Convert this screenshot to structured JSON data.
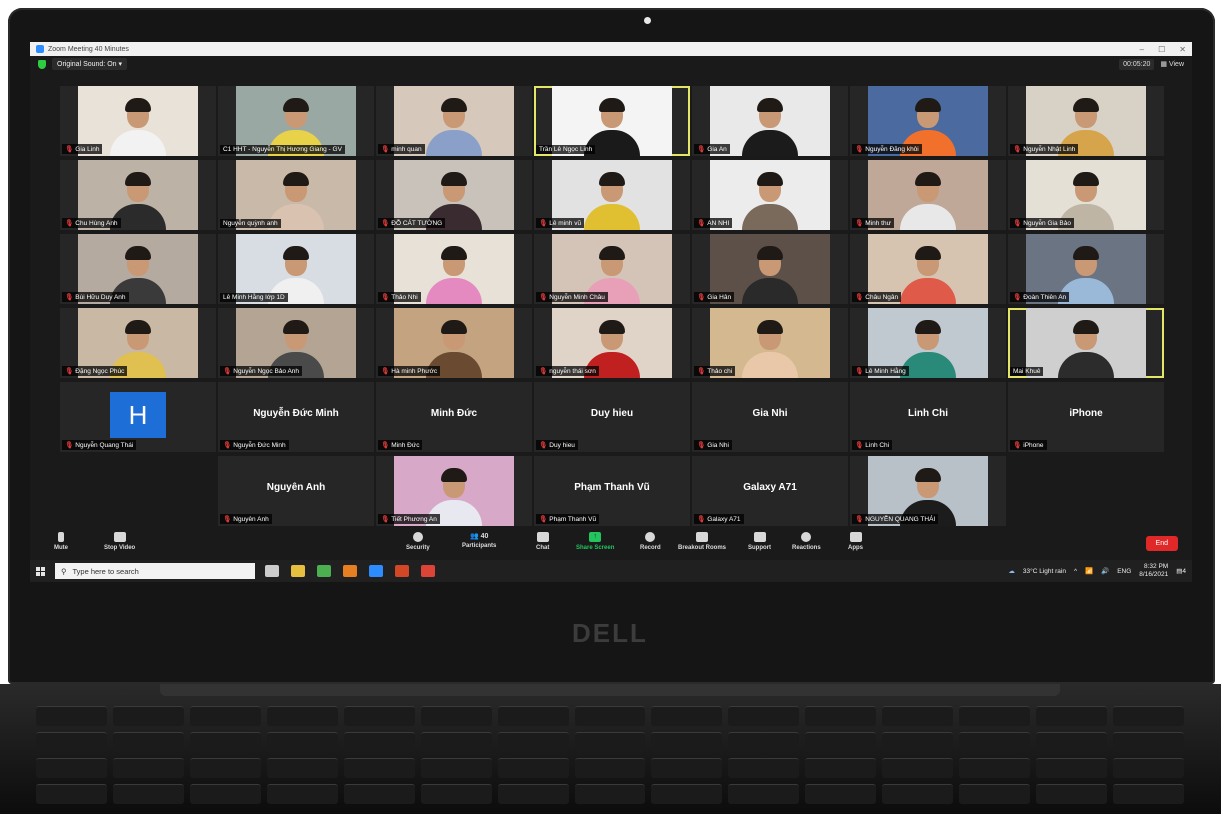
{
  "window": {
    "title": "Zoom Meeting 40 Minutes"
  },
  "topbar": {
    "sound_label": "Original Sound: On",
    "timer": "00:05:20",
    "view_label": "View"
  },
  "brand": "DELL",
  "tiles": [
    {
      "name": "Gia Linh",
      "muted": true,
      "video": true,
      "bg": "#e9e2d8",
      "shirt": "#f2f2f2"
    },
    {
      "name": "C1 HHT - Nguyễn Thị Hương Giang - GV",
      "muted": false,
      "video": true,
      "bg": "#9aa8a4",
      "shirt": "#e8d24a"
    },
    {
      "name": "minh quan",
      "muted": true,
      "video": true,
      "bg": "#d7c8bc",
      "shirt": "#8aa0c8"
    },
    {
      "name": "Trần Lê Ngọc Linh",
      "muted": false,
      "video": true,
      "bg": "#f4f4f4",
      "shirt": "#1a1a1a",
      "active": true
    },
    {
      "name": "Gia An",
      "muted": true,
      "video": true,
      "bg": "#e9e9e9",
      "shirt": "#1b1b1b"
    },
    {
      "name": "Nguyễn Đăng khôi",
      "muted": true,
      "video": true,
      "bg": "#4a6aa0",
      "shirt": "#f0702c"
    },
    {
      "name": "Nguyễn Nhật Linh",
      "muted": true,
      "video": true,
      "bg": "#d8d2c6",
      "shirt": "#d6a44a"
    },
    {
      "name": "Chu Hùng Anh",
      "muted": true,
      "video": true,
      "bg": "#bcb3a6",
      "shirt": "#2b2b2b"
    },
    {
      "name": "Nguyễn quỳnh anh",
      "muted": false,
      "video": true,
      "bg": "#c9b9a8",
      "shirt": "#d9c2b0"
    },
    {
      "name": "ĐỖ CÁT TƯỜNG",
      "muted": true,
      "video": true,
      "bg": "#c8c2ba",
      "shirt": "#3a2b30"
    },
    {
      "name": "Lê minh vũ",
      "muted": true,
      "video": true,
      "bg": "#e2e2e2",
      "shirt": "#e0c030"
    },
    {
      "name": "AN NHI",
      "muted": true,
      "video": true,
      "bg": "#ececec",
      "shirt": "#7a6a5c"
    },
    {
      "name": "Minh thư",
      "muted": true,
      "video": true,
      "bg": "#c0a898",
      "shirt": "#e8e8e8"
    },
    {
      "name": "Nguyễn Gia Bảo",
      "muted": true,
      "video": true,
      "bg": "#e5e0d6",
      "shirt": "#bfb5a5"
    },
    {
      "name": "Bùi Hữu Duy Anh",
      "muted": true,
      "video": true,
      "bg": "#b5aaa0",
      "shirt": "#3a3a3a"
    },
    {
      "name": "Lê Minh Hằng  lớp 1D",
      "muted": false,
      "video": true,
      "bg": "#d8dde4",
      "shirt": "#f0f0f0"
    },
    {
      "name": "Thảo Nhi",
      "muted": true,
      "video": true,
      "bg": "#e8e1d8",
      "shirt": "#e48ac0"
    },
    {
      "name": "Nguyễn Minh Châu",
      "muted": true,
      "video": true,
      "bg": "#d4c4b8",
      "shirt": "#e8a0b8"
    },
    {
      "name": "Gia Hân",
      "muted": true,
      "video": true,
      "bg": "#5c5048",
      "shirt": "#2a2a2a"
    },
    {
      "name": "Châu Ngân",
      "muted": true,
      "video": true,
      "bg": "#d6c4b0",
      "shirt": "#e05a4a"
    },
    {
      "name": "Đoàn Thiên An",
      "muted": true,
      "video": true,
      "bg": "#6a7482",
      "shirt": "#9ab8d8"
    },
    {
      "name": "Đặng Ngọc Phúc",
      "muted": true,
      "video": true,
      "bg": "#c8b8a4",
      "shirt": "#e0c050"
    },
    {
      "name": "Nguyễn Ngọc Bảo Anh",
      "muted": true,
      "video": true,
      "bg": "#b4a494",
      "shirt": "#4a4a4a"
    },
    {
      "name": "Hà minh Phước",
      "muted": true,
      "video": true,
      "bg": "#c4a480",
      "shirt": "#6a4a30"
    },
    {
      "name": "nguyễn thái sơn",
      "muted": true,
      "video": true,
      "bg": "#e0d4c8",
      "shirt": "#c02020"
    },
    {
      "name": "Thảo chi",
      "muted": true,
      "video": true,
      "bg": "#d4b890",
      "shirt": "#e8c8a8"
    },
    {
      "name": "Lê Minh Hằng",
      "muted": true,
      "video": true,
      "bg": "#c0c8d0",
      "shirt": "#2a8a7a"
    },
    {
      "name": "Mai Khuê",
      "muted": false,
      "video": true,
      "bg": "#cfcfcf",
      "shirt": "#2c2c2c",
      "active": true
    },
    {
      "name": "Nguyễn Quang Thái",
      "muted": true,
      "video": false,
      "avatar": "H"
    },
    {
      "name": "Nguyễn Đức Minh",
      "muted": true,
      "video": false,
      "display": "Nguyễn Đức Minh"
    },
    {
      "name": "Minh Đức",
      "muted": true,
      "video": false,
      "display": "Minh Đức"
    },
    {
      "name": "Duy hieu",
      "muted": true,
      "video": false,
      "display": "Duy hieu"
    },
    {
      "name": "Gia Nhi",
      "muted": true,
      "video": false,
      "display": "Gia Nhi"
    },
    {
      "name": "Linh Chi",
      "muted": true,
      "video": false,
      "display": "Linh Chi"
    },
    {
      "name": "iPhone",
      "muted": true,
      "video": false,
      "display": "iPhone"
    },
    {
      "name": "Nguyên Anh",
      "muted": true,
      "video": false,
      "display": "Nguyên Anh",
      "col": 2
    },
    {
      "name": "Tiết Phương An",
      "muted": true,
      "video": true,
      "bg": "#d8a8c8",
      "shirt": "#e8e8f0"
    },
    {
      "name": "Phạm Thanh Vũ",
      "muted": true,
      "video": false,
      "display": "Phạm Thanh Vũ"
    },
    {
      "name": "Galaxy A71",
      "muted": true,
      "video": false,
      "display": "Galaxy A71"
    },
    {
      "name": "NGUYỄN QUANG THÁI",
      "muted": true,
      "video": true,
      "bg": "#b8c0c8",
      "shirt": "#1c1c1c"
    }
  ],
  "toolbar": {
    "mute": "Mute",
    "stop_video": "Stop Video",
    "security": "Security",
    "participants": "Participants",
    "participants_count": "40",
    "chat": "Chat",
    "share_screen": "Share Screen",
    "record": "Record",
    "breakout": "Breakout Rooms",
    "support": "Support",
    "reactions": "Reactions",
    "apps": "Apps",
    "end": "End"
  },
  "taskbar": {
    "search_placeholder": "Type here to search",
    "weather": "33°C  Light rain",
    "lang": "ENG",
    "time": "8:32 PM",
    "date": "8/16/2021",
    "notif_count": "4",
    "apps": [
      {
        "icon": "task-view-icon",
        "color": "#cccccc"
      },
      {
        "icon": "file-explorer-icon",
        "color": "#e8c040"
      },
      {
        "icon": "chrome-icon",
        "color": "#4caf50"
      },
      {
        "icon": "zoom-app-icon",
        "color": "#e67e22"
      },
      {
        "icon": "zoom-icon",
        "color": "#2d8cff"
      },
      {
        "icon": "powerpoint-icon",
        "color": "#d24726"
      },
      {
        "icon": "chrome-profile-icon",
        "color": "#db4437"
      }
    ]
  }
}
